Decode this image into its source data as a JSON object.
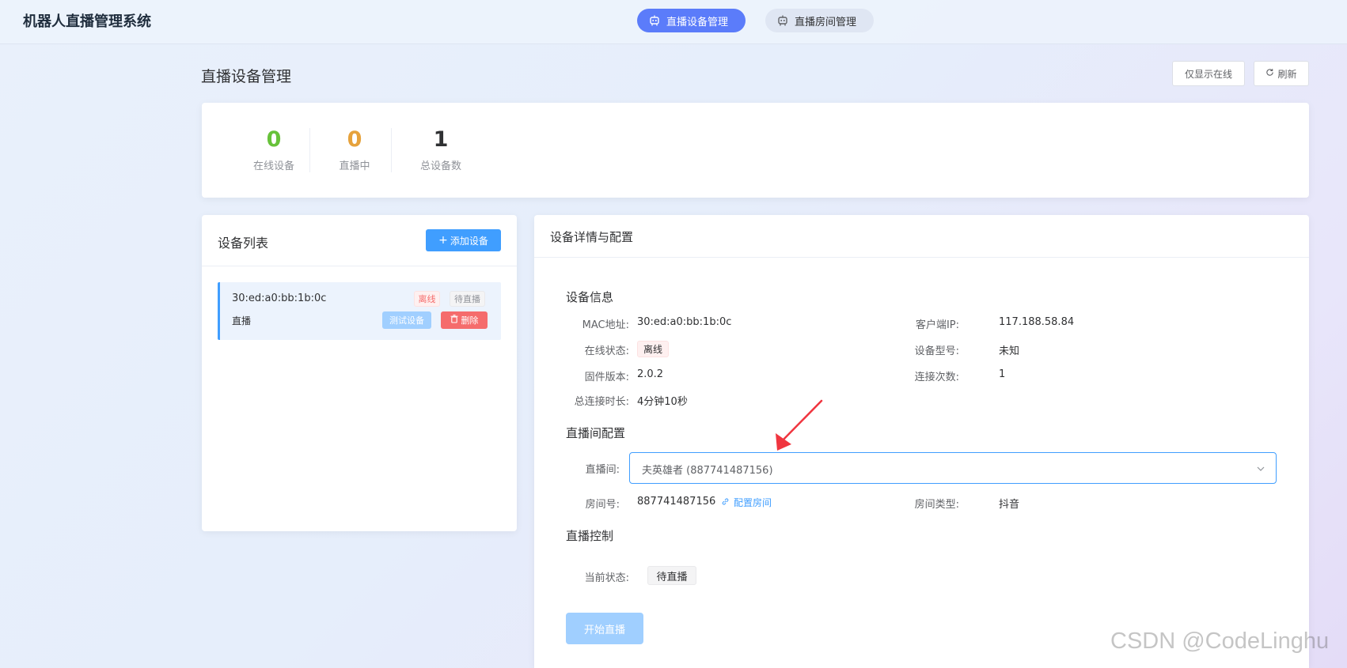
{
  "header": {
    "app_title": "机器人直播管理系统",
    "tabs": [
      {
        "label": "直播设备管理",
        "icon": "robot-icon",
        "active": true
      },
      {
        "label": "直播房间管理",
        "icon": "robot-icon",
        "active": false
      }
    ]
  },
  "page": {
    "title": "直播设备管理",
    "online_only_label": "仅显示在线",
    "refresh_label": "刷新"
  },
  "stats": [
    {
      "value": "0",
      "label": "在线设备",
      "color": "#67c23a"
    },
    {
      "value": "0",
      "label": "直播中",
      "color": "#e6a23c"
    },
    {
      "value": "1",
      "label": "总设备数",
      "color": "#303133"
    }
  ],
  "device_list": {
    "title": "设备列表",
    "add_label": "添加设备",
    "items": [
      {
        "mac": "30:ed:a0:bb:1b:0c",
        "type": "直播",
        "status_tag": "离线",
        "live_tag": "待直播",
        "test_label": "测试设备",
        "delete_label": "删除"
      }
    ]
  },
  "detail": {
    "title": "设备详情与配置",
    "info_title": "设备信息",
    "mac_label": "MAC地址:",
    "mac_value": "30:ed:a0:bb:1b:0c",
    "ip_label": "客户端IP:",
    "ip_value": "117.188.58.84",
    "online_label": "在线状态:",
    "online_value": "离线",
    "model_label": "设备型号:",
    "model_value": "未知",
    "firmware_label": "固件版本:",
    "firmware_value": "2.0.2",
    "conn_count_label": "连接次数:",
    "conn_count_value": "1",
    "duration_label": "总连接时长:",
    "duration_value": "4分钟10秒",
    "room_cfg_title": "直播间配置",
    "room_label": "直播间:",
    "room_value": "夫英雄者 (887741487156)",
    "room_no_label": "房间号:",
    "room_no_value": "887741487156",
    "config_room_label": "配置房间",
    "room_type_label": "房间类型:",
    "room_type_value": "抖音",
    "control_title": "直播控制",
    "current_status_label": "当前状态:",
    "current_status_value": "待直播",
    "start_label": "开始直播"
  },
  "watermark": "CSDN @CodeLinghu",
  "colors": {
    "primary": "#409eff",
    "nav_active": "#5b7cfa",
    "danger": "#f56c6c",
    "arrow": "#f0353f"
  }
}
